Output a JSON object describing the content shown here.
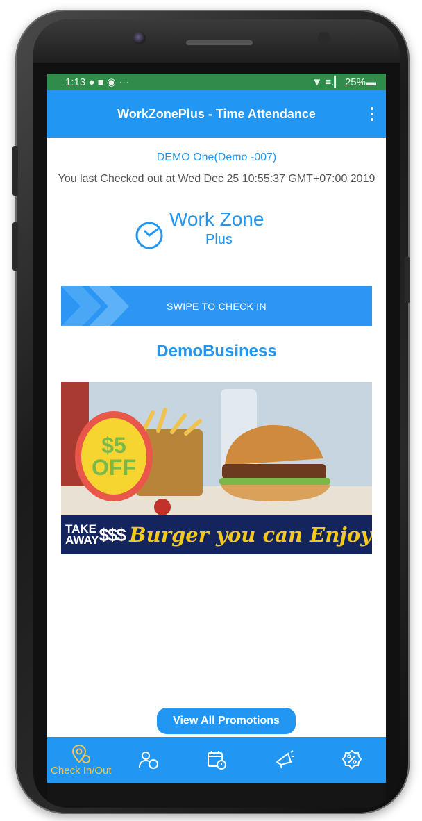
{
  "status_bar": {
    "time": "1:13",
    "indicators": "● ■ ◉  ···",
    "right": "▼ ≡.▎ 25%▬"
  },
  "app_bar": {
    "title": "WorkZonePlus - Time Attendance",
    "menu_icon": "overflow-menu-icon"
  },
  "user": {
    "name": "DEMO One(Demo -007)",
    "last_check": "You last Checked out at Wed Dec 25 10:55:37 GMT+07:00 2019"
  },
  "logo": {
    "word1": "Work Zone",
    "word2": "Plus"
  },
  "swipe": {
    "label": "SWIPE TO CHECK IN"
  },
  "business": {
    "name": "DemoBusiness"
  },
  "promo": {
    "badge_line1": "$5",
    "badge_line2": "OFF",
    "take_line1": "TAKE",
    "take_line2": "AWAY",
    "dollars": "$$$",
    "headline": "Burger you can Enjoy"
  },
  "actions": {
    "view_all_promotions": "View All Promotions"
  },
  "bottom_nav": {
    "items": [
      {
        "icon": "location-pin-icon",
        "label": "Check In/Out",
        "active": true
      },
      {
        "icon": "people-icon",
        "label": "",
        "active": false
      },
      {
        "icon": "calendar-clock-icon",
        "label": "",
        "active": false
      },
      {
        "icon": "megaphone-icon",
        "label": "",
        "active": false
      },
      {
        "icon": "percent-badge-icon",
        "label": "",
        "active": false
      }
    ]
  },
  "colors": {
    "primary": "#2196f3",
    "status_bar": "#2f8c4a",
    "active_nav": "#f7c64b"
  }
}
